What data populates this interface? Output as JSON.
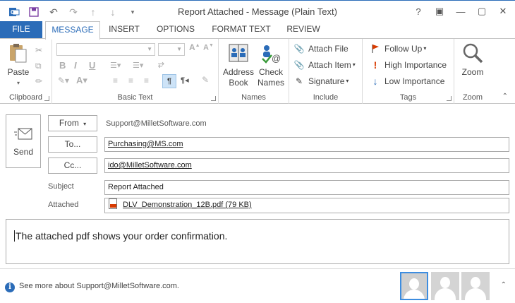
{
  "window": {
    "title": "Report Attached - Message (Plain Text)",
    "controls": [
      "?",
      "▣",
      "—",
      "▢",
      "✕"
    ]
  },
  "tabs": {
    "file": "FILE",
    "message": "MESSAGE",
    "insert": "INSERT",
    "options": "OPTIONS",
    "format_text": "FORMAT TEXT",
    "review": "REVIEW"
  },
  "ribbon": {
    "clipboard": {
      "label": "Clipboard",
      "paste": "Paste"
    },
    "basic_text": {
      "label": "Basic Text"
    },
    "names": {
      "label": "Names",
      "address_book_1": "Address",
      "address_book_2": "Book",
      "check_names_1": "Check",
      "check_names_2": "Names"
    },
    "include": {
      "label": "Include",
      "attach_file": "Attach File",
      "attach_item": "Attach Item",
      "signature": "Signature"
    },
    "tags": {
      "label": "Tags",
      "follow_up": "Follow Up",
      "high_importance": "High Importance",
      "low_importance": "Low Importance"
    },
    "zoom": {
      "label": "Zoom",
      "zoom_button": "Zoom"
    }
  },
  "compose": {
    "send": "Send",
    "from_button": "From",
    "from_value": "Support@MilletSoftware.com",
    "to_button": "To...",
    "to_value": "Purchasing@MS.com",
    "cc_button": "Cc...",
    "cc_value": "ido@MilletSoftware.com",
    "subject_label": "Subject",
    "subject_value": "Report Attached",
    "attached_label": "Attached",
    "attachment": "DLV_Demonstration_12B.pdf (79 KB)",
    "body": "The attached pdf shows your order confirmation."
  },
  "status": {
    "info_text": "See more about Support@MilletSoftware.com."
  },
  "colors": {
    "accent": "#2b6cb8",
    "flag_red": "#d83b01",
    "low_importance_blue": "#2b6cb8",
    "avatar_selected_border": "#3d8de0"
  }
}
